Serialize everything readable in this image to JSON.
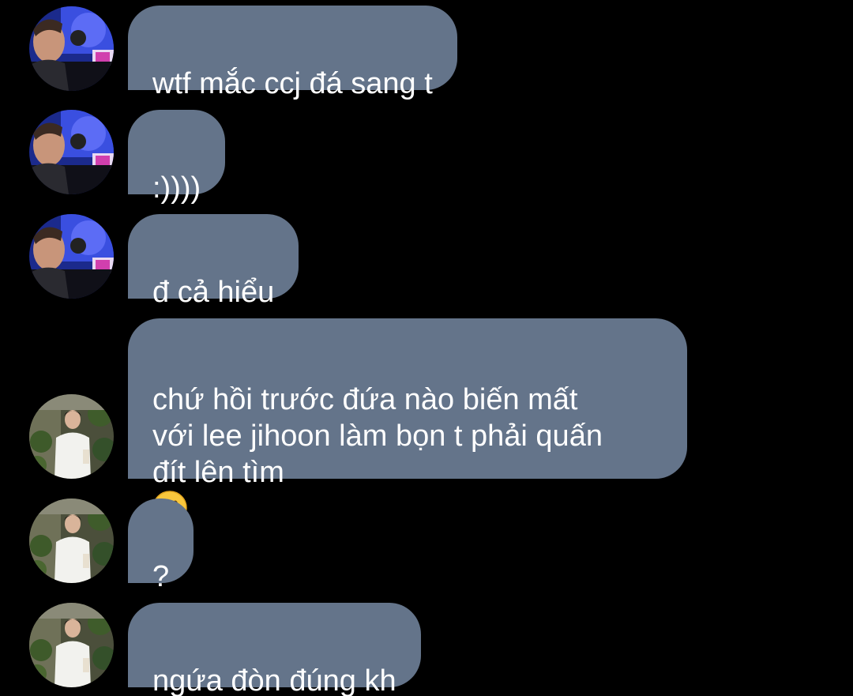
{
  "messages": [
    {
      "sender": "user-a",
      "text": "wtf mắc ccj đá sang t"
    },
    {
      "sender": "user-a",
      "text": ":))))"
    },
    {
      "sender": "user-a",
      "text": "đ cả hiểu"
    },
    {
      "sender": "user-b",
      "text": "chứ hồi trước đứa nào biến mất\nvới lee jihoon làm bọn t phải quấn\nđít lên tìm",
      "emoji": "slightly-smiling-face"
    },
    {
      "sender": "user-b",
      "text": "?"
    },
    {
      "sender": "user-b",
      "text": "ngứa đòn đúng kh"
    }
  ],
  "colors": {
    "background": "#000000",
    "bubble": "#64748a",
    "text": "#ffffff"
  }
}
